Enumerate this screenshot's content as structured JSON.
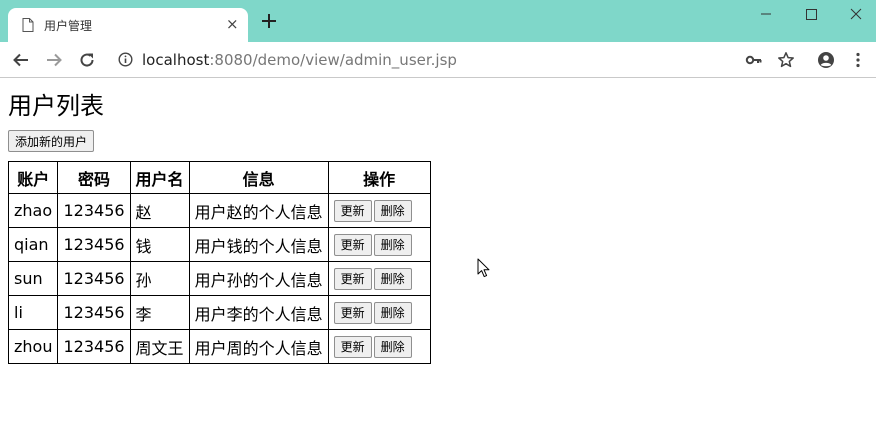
{
  "browser": {
    "tab_title": "用户管理",
    "tab_close": "×",
    "url_host": "localhost",
    "url_rest": ":8080/demo/view/admin_user.jsp",
    "accent_color": "#7fd7c9"
  },
  "page": {
    "title": "用户列表",
    "add_button": "添加新的用户"
  },
  "table": {
    "headers": [
      "账户",
      "密码",
      "用户名",
      "信息",
      "操作"
    ],
    "rows": [
      {
        "account": "zhao",
        "password": "123456",
        "name": "赵",
        "info": "用户赵的个人信息",
        "update": "更新",
        "delete": "删除"
      },
      {
        "account": "qian",
        "password": "123456",
        "name": "钱",
        "info": "用户钱的个人信息",
        "update": "更新",
        "delete": "删除"
      },
      {
        "account": "sun",
        "password": "123456",
        "name": "孙",
        "info": "用户孙的个人信息",
        "update": "更新",
        "delete": "删除"
      },
      {
        "account": "li",
        "password": "123456",
        "name": "李",
        "info": "用户李的个人信息",
        "update": "更新",
        "delete": "删除"
      },
      {
        "account": "zhou",
        "password": "123456",
        "name": "周文王",
        "info": "用户周的个人信息",
        "update": "更新",
        "delete": "删除"
      }
    ]
  },
  "icons": [
    "document-icon",
    "plus-icon",
    "minimize-icon",
    "maximize-icon",
    "close-icon",
    "back-arrow-icon",
    "forward-arrow-icon",
    "reload-icon",
    "info-icon",
    "key-icon",
    "star-icon",
    "account-icon",
    "more-vert-icon",
    "mouse-cursor-icon"
  ]
}
